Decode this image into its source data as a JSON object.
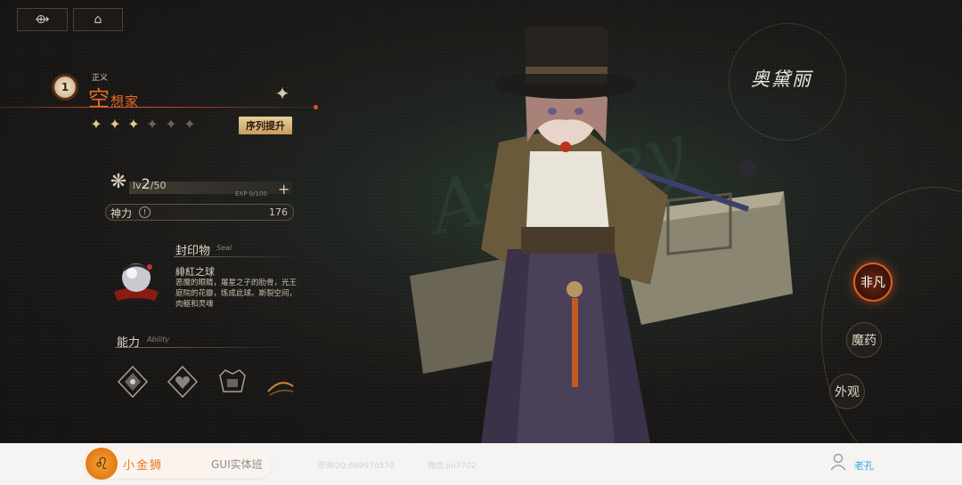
{
  "top_bar": {
    "back_glyph": "⟴",
    "home_glyph": "⌂"
  },
  "sequence": {
    "rank_number": "1",
    "pathway_small": "正义",
    "title_big": "空",
    "title_suffix": "想家",
    "stars_total": 6,
    "stars_filled": 3,
    "promote_label": "序列提升"
  },
  "level": {
    "prefix": "lv",
    "current": "2",
    "max": "/50",
    "exp": "EXP 0/100"
  },
  "power": {
    "label": "神力",
    "value": "176"
  },
  "seal": {
    "section_title": "封印物",
    "section_sub": "Seal",
    "item_name": "緋紅之球",
    "item_desc": "恶魔的眼睛，屠星之子的肋骨，光王庭院的花瓣，炼成此球。斯裂空间，肉躯和灵魂"
  },
  "ability": {
    "section_title": "能力",
    "section_sub": "Ability"
  },
  "character": {
    "name": "奥黛丽"
  },
  "side_menu": {
    "items": [
      {
        "label": "非凡",
        "active": true
      },
      {
        "label": "魔药",
        "active": false
      },
      {
        "label": "外观",
        "active": false
      }
    ]
  },
  "footer": {
    "brand": "小金狮",
    "course": "GUI实体班",
    "qq": "咨询QQ:669970570",
    "wechat": "微信:jin7702",
    "user": "老孔"
  },
  "colors": {
    "accent": "#e0542a",
    "gold": "#e8c98a",
    "link": "#29a7e0",
    "brand": "#e8761e"
  }
}
